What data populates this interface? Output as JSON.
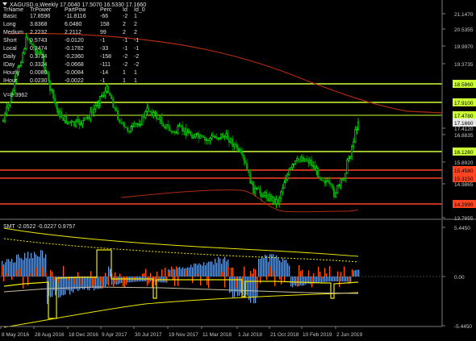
{
  "header": {
    "symbol_line": "XAGUSD.o,Weekly  17.0040 17.5070 16.5330 17.1660"
  },
  "table": {
    "headers": [
      "TrName",
      "TrPower",
      "PartPow",
      "Perc",
      "Id",
      "Id_0"
    ],
    "rows": [
      [
        "Basic",
        "17.8596",
        "-11.8116",
        "-66",
        "-2",
        "1"
      ],
      [
        "Long",
        "3.8368",
        "6.0480",
        "158",
        "2",
        "2"
      ],
      [
        "Medium",
        "2.2232",
        "2.2112",
        "99",
        "2",
        "2"
      ],
      [
        "Short",
        "0.5743",
        "-0.0120",
        "-1",
        "-1",
        "-1"
      ],
      [
        "Local",
        "0.3474",
        "-0.1782",
        "-33",
        "-1",
        "-1"
      ],
      [
        "Daily",
        "0.3734",
        "-0.2360",
        "-158",
        "-2",
        "-2"
      ],
      [
        "IDay",
        "0.3324",
        "-0.0668",
        "-111",
        "-2",
        "-2"
      ],
      [
        "Hourly",
        "0.0080",
        "-0.0084",
        "-14",
        "1",
        "1"
      ],
      [
        "IHour",
        "0.0230",
        "-0.0022",
        "-1",
        "1",
        "1"
      ]
    ],
    "v_line": "V=0.3962"
  },
  "main_axis": {
    "ticks": [
      "21.1470",
      "20.5355",
      "19.9970",
      "19.3735",
      "17.4120",
      "16.8835",
      "15.8920",
      "14.9865",
      "13.7655"
    ],
    "level_labels": [
      {
        "text": "18.5860",
        "style": "yellow"
      },
      {
        "text": "17.9100",
        "style": "yellow"
      },
      {
        "text": "17.4780",
        "style": "yellow"
      },
      {
        "text": "17.1660",
        "style": "white"
      },
      {
        "text": "16.1280",
        "style": "yellow"
      },
      {
        "text": "15.4580",
        "style": "red"
      },
      {
        "text": "15.3150",
        "style": "red"
      },
      {
        "text": "14.2990",
        "style": "red"
      }
    ]
  },
  "sub_window": {
    "indicator_label": "SMT -2.0522 -0.0227 0.9757",
    "axis_ticks": [
      "5.4450",
      "0.00",
      "-5.4450"
    ]
  },
  "time_axis": {
    "labels": [
      "8 May 2016",
      "28 Aug 2016",
      "18 Dec 2016",
      "9 Apr 2017",
      "30 Jul 2017",
      "19 Nov 2017",
      "11 Mar 2018",
      "1 Jul 2018",
      "21 Oct 2018",
      "10 Feb 2019",
      "2 Jun 2019"
    ]
  },
  "colors": {
    "background": "#000000",
    "bull_candle": "#00ff00",
    "bear_candle": "#00a000",
    "level_yellow": "#ccff33",
    "level_red": "#ff4422",
    "moving_average": "#b02a10",
    "histogram_blue": "#6a9ad8",
    "histogram_orange": "#ff5a00",
    "band_yellow": "#f0e800"
  }
}
